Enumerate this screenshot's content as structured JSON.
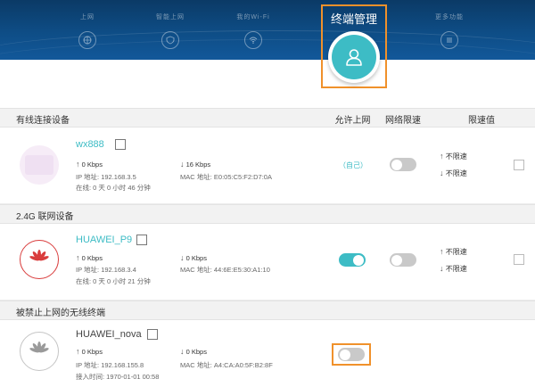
{
  "header": {
    "nav_items": [
      {
        "label": "上网",
        "icon": "globe-icon"
      },
      {
        "label": "智能上网",
        "icon": "shield-icon"
      },
      {
        "label": "我的Wi-Fi",
        "icon": "wifi-icon"
      },
      {
        "label": "更多功能",
        "icon": "menu-icon"
      }
    ],
    "active_tab": {
      "label": "终端管理",
      "icon": "user-icon"
    }
  },
  "table": {
    "columns": {
      "allow": "允许上网",
      "limit": "网络限速",
      "limit_value": "限速值"
    }
  },
  "sections": {
    "wired": "有线连接设备",
    "wireless": "2.4G 联网设备",
    "blocked": "被禁止上网的无线终端"
  },
  "devices": [
    {
      "name": "wx888",
      "up": "0 Kbps",
      "down": "16 Kbps",
      "ip": "IP 地址: 192.168.3.5",
      "mac": "MAC 地址: E0:05:C5:F2:D7:0A",
      "time": "在线: 0 天 0 小时 46 分钟",
      "allow_text": "（自己）",
      "limit_up": "不限速",
      "limit_down": "不限速"
    },
    {
      "name": "HUAWEI_P9",
      "up": "0 Kbps",
      "down": "0 Kbps",
      "ip": "IP 地址: 192.168.3.4",
      "mac": "MAC 地址: 44:6E:E5:30:A1:10",
      "time": "在线: 0 天 0 小时 21 分钟",
      "limit_up": "不限速",
      "limit_down": "不限速"
    },
    {
      "name": "HUAWEI_nova",
      "up": "0 Kbps",
      "down": "0 Kbps",
      "ip": "IP 地址: 192.168.155.8",
      "mac": "MAC 地址: A4:CA:A0:5F:B2:8F",
      "time": "接入时间: 1970-01-01 00:58"
    }
  ],
  "colors": {
    "accent": "#3dbcc5",
    "highlight": "#f0912b",
    "header": "#0e4d86"
  }
}
